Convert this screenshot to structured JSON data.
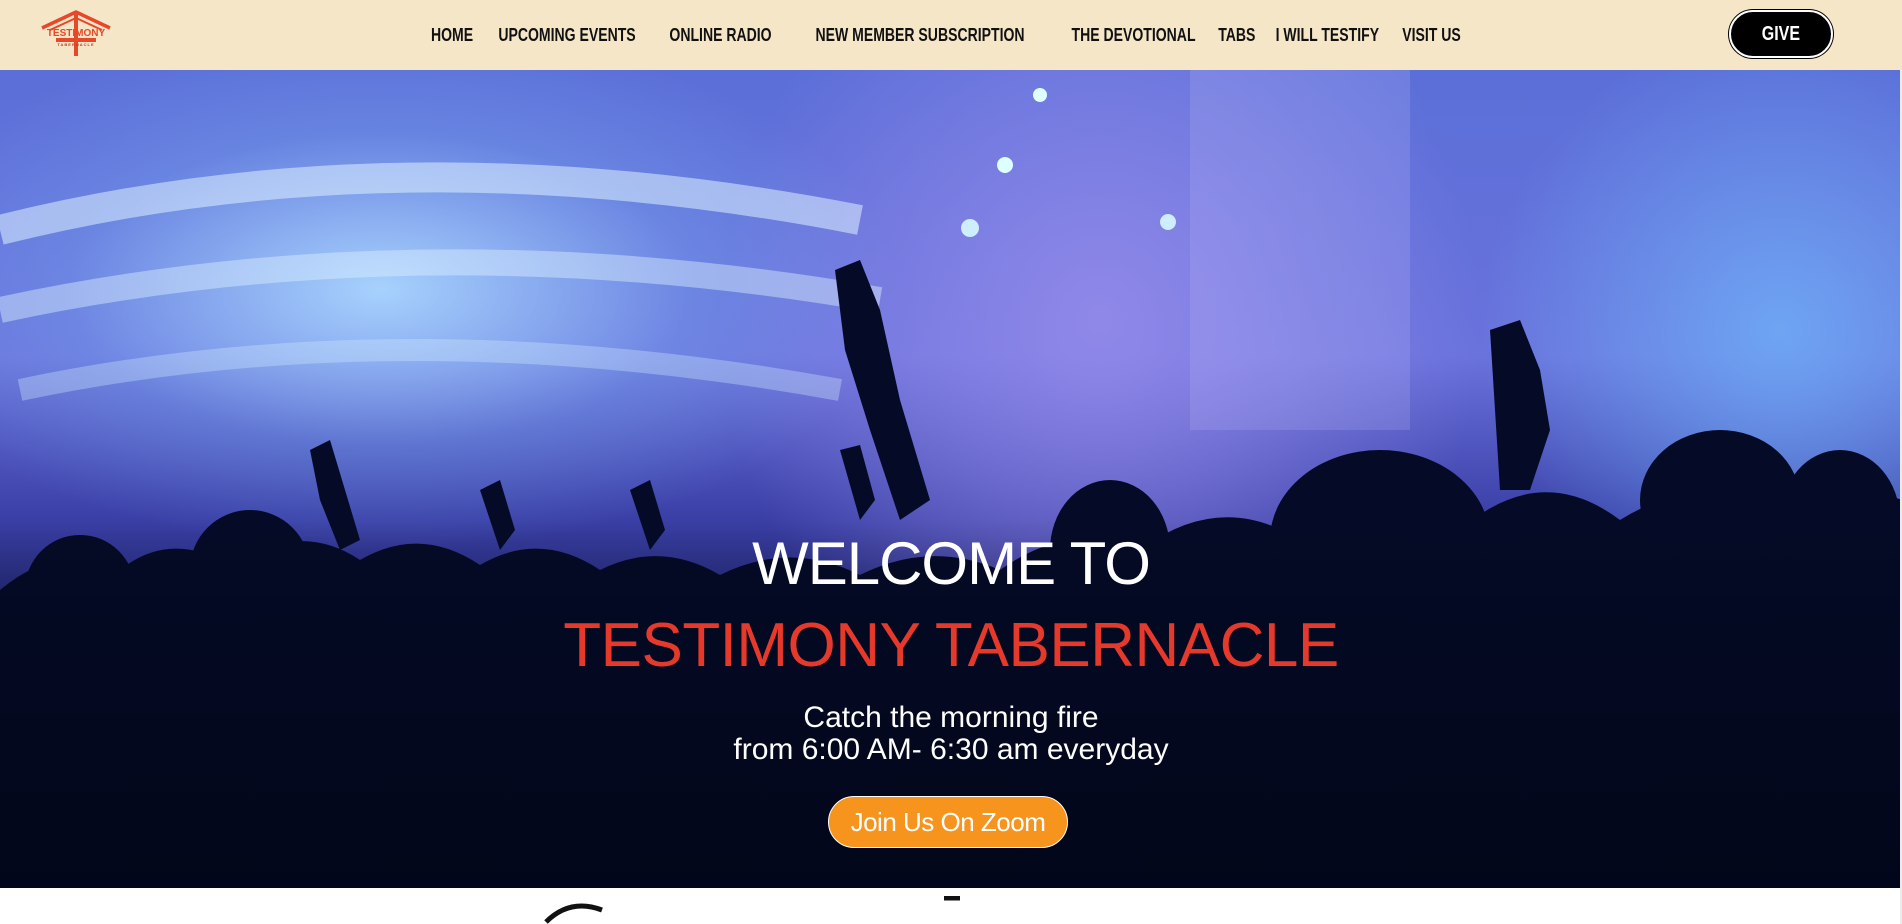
{
  "header": {
    "logo_text": "TESTIMONY",
    "logo_subtext": "TABERNACLE",
    "nav": [
      {
        "label": "HOME"
      },
      {
        "label": "UPCOMING EVENTS"
      },
      {
        "label": "ONLINE RADIO"
      },
      {
        "label": "NEW MEMBER SUBSCRIPTION"
      },
      {
        "label": "THE DEVOTIONAL"
      },
      {
        "label": "TABS"
      },
      {
        "label": "I WILL TESTIFY"
      },
      {
        "label": "VISIT US"
      }
    ],
    "give_label": "GIVE"
  },
  "hero": {
    "welcome": "WELCOME TO",
    "church_name": "TESTIMONY TABERNACLE",
    "tagline_line1": "Catch the morning fire",
    "tagline_line2": "from 6:00 AM- 6:30 am everyday",
    "cta_label": "Join Us On Zoom"
  },
  "colors": {
    "header_bg": "#f6e6c8",
    "accent_red": "#e5392b",
    "cta_orange": "#f7941d",
    "give_bg": "#000000"
  }
}
